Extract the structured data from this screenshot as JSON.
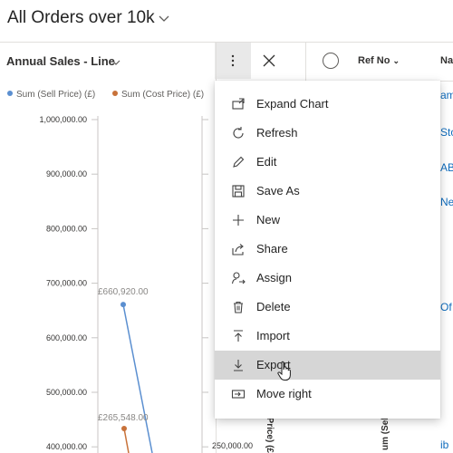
{
  "view": {
    "title": "All Orders over 10k"
  },
  "chart_panel": {
    "title": "Annual Sales - Line",
    "legend": [
      {
        "label": "Sum (Sell Price) (£)",
        "color": "#5b8fd0"
      },
      {
        "label": "Sum (Cost Price) (£)",
        "color": "#c8723a"
      }
    ],
    "left_axis_ticks": [
      "1,000,000.00",
      "900,000.00",
      "800,000.00",
      "700,000.00",
      "600,000.00",
      "500,000.00",
      "400,000.00"
    ],
    "left_axis_title": "um (Sell Price) (£)",
    "right_axis_tick": "250,000.00",
    "right_axis_title": "Price) (£",
    "data_labels": [
      "£660,920.00",
      "£265,548.00"
    ]
  },
  "chart_data": {
    "type": "line",
    "series": [
      {
        "name": "Sum (Sell Price) (£)",
        "values": [
          660920
        ],
        "color": "#5b8fd0"
      },
      {
        "name": "Sum (Cost Price) (£)",
        "values": [
          265548
        ],
        "color": "#c8723a"
      }
    ],
    "ylabel": "um (Sell Price) (£)",
    "y2label": "Price) (£",
    "ylim": [
      400000,
      1000000
    ],
    "legend_position": "top"
  },
  "grid": {
    "ref_header": "Ref No",
    "name_header": "Na",
    "cells": [
      "am",
      "Sto",
      "AB",
      "Ne",
      "Of",
      "ib"
    ]
  },
  "menu": {
    "items": [
      {
        "label": "Expand Chart",
        "icon": "expand-chart-icon"
      },
      {
        "label": "Refresh",
        "icon": "refresh-icon"
      },
      {
        "label": "Edit",
        "icon": "pencil-icon"
      },
      {
        "label": "Save As",
        "icon": "save-icon"
      },
      {
        "label": "New",
        "icon": "plus-icon"
      },
      {
        "label": "Share",
        "icon": "share-icon"
      },
      {
        "label": "Assign",
        "icon": "assign-user-icon"
      },
      {
        "label": "Delete",
        "icon": "trash-icon"
      },
      {
        "label": "Import",
        "icon": "import-icon"
      },
      {
        "label": "Export",
        "icon": "export-icon",
        "hovered": true
      },
      {
        "label": "Move right",
        "icon": "move-right-icon"
      }
    ]
  }
}
